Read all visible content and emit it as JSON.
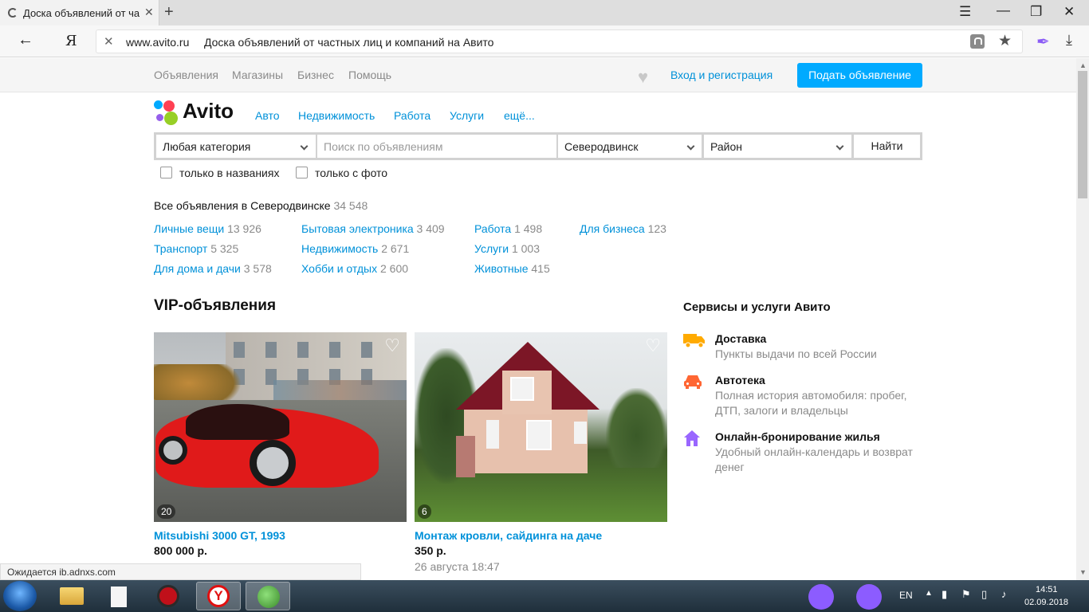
{
  "browser": {
    "tab_title": "Доска объявлений от ча",
    "url_domain": "www.avito.ru",
    "url_title": "Доска объявлений от частных лиц и компаний на Авито",
    "ya_label": "Я"
  },
  "topnav": {
    "links": [
      "Объявления",
      "Магазины",
      "Бизнес",
      "Помощь"
    ],
    "login": "Вход и регистрация",
    "post_ad": "Подать объявление"
  },
  "logo": {
    "text": "Avito"
  },
  "catnav": [
    "Авто",
    "Недвижимость",
    "Работа",
    "Услуги",
    "ещё..."
  ],
  "search": {
    "category": "Любая категория",
    "placeholder": "Поиск по объявлениям",
    "city": "Северодвинск",
    "district": "Район",
    "button": "Найти",
    "only_titles": "только в названиях",
    "only_photo": "только с фото"
  },
  "all_ads": {
    "label": "Все объявления в Северодвинске",
    "count": "34 548"
  },
  "categories": [
    [
      {
        "name": "Личные вещи",
        "count": "13 926"
      },
      {
        "name": "Транспорт",
        "count": "5 325"
      },
      {
        "name": "Для дома и дачи",
        "count": "3 578"
      }
    ],
    [
      {
        "name": "Бытовая электроника",
        "count": "3 409"
      },
      {
        "name": "Недвижимость",
        "count": "2 671"
      },
      {
        "name": "Хобби и отдых",
        "count": "2 600"
      }
    ],
    [
      {
        "name": "Работа",
        "count": "1 498"
      },
      {
        "name": "Услуги",
        "count": "1 003"
      },
      {
        "name": "Животные",
        "count": "415"
      }
    ],
    [
      {
        "name": "Для бизнеса",
        "count": "123"
      }
    ]
  ],
  "vip": {
    "title": "VIP-объявления",
    "cards": [
      {
        "title": "Mitsubishi 3000 GT, 1993",
        "price": "800 000 р.",
        "photos": "20"
      },
      {
        "title": "Монтаж кровли, сайдинга на даче",
        "price": "350 р.",
        "date": "26 августа 18:47",
        "photos": "6"
      }
    ]
  },
  "services": {
    "title": "Сервисы и услуги Авито",
    "items": [
      {
        "name": "Доставка",
        "desc": "Пункты выдачи по всей России",
        "color": "#ffaa00"
      },
      {
        "name": "Автотека",
        "desc": "Полная история автомобиля: пробег, ДТП, залоги и владельцы",
        "color": "#ff6633"
      },
      {
        "name": "Онлайн-бронирование жилья",
        "desc": "Удобный онлайн-календарь и возврат денег",
        "color": "#9966ff"
      }
    ]
  },
  "status": {
    "text": "Ожидается ib.adnxs.com"
  },
  "taskbar": {
    "lang": "EN",
    "time": "14:51",
    "date": "02.09.2018"
  }
}
